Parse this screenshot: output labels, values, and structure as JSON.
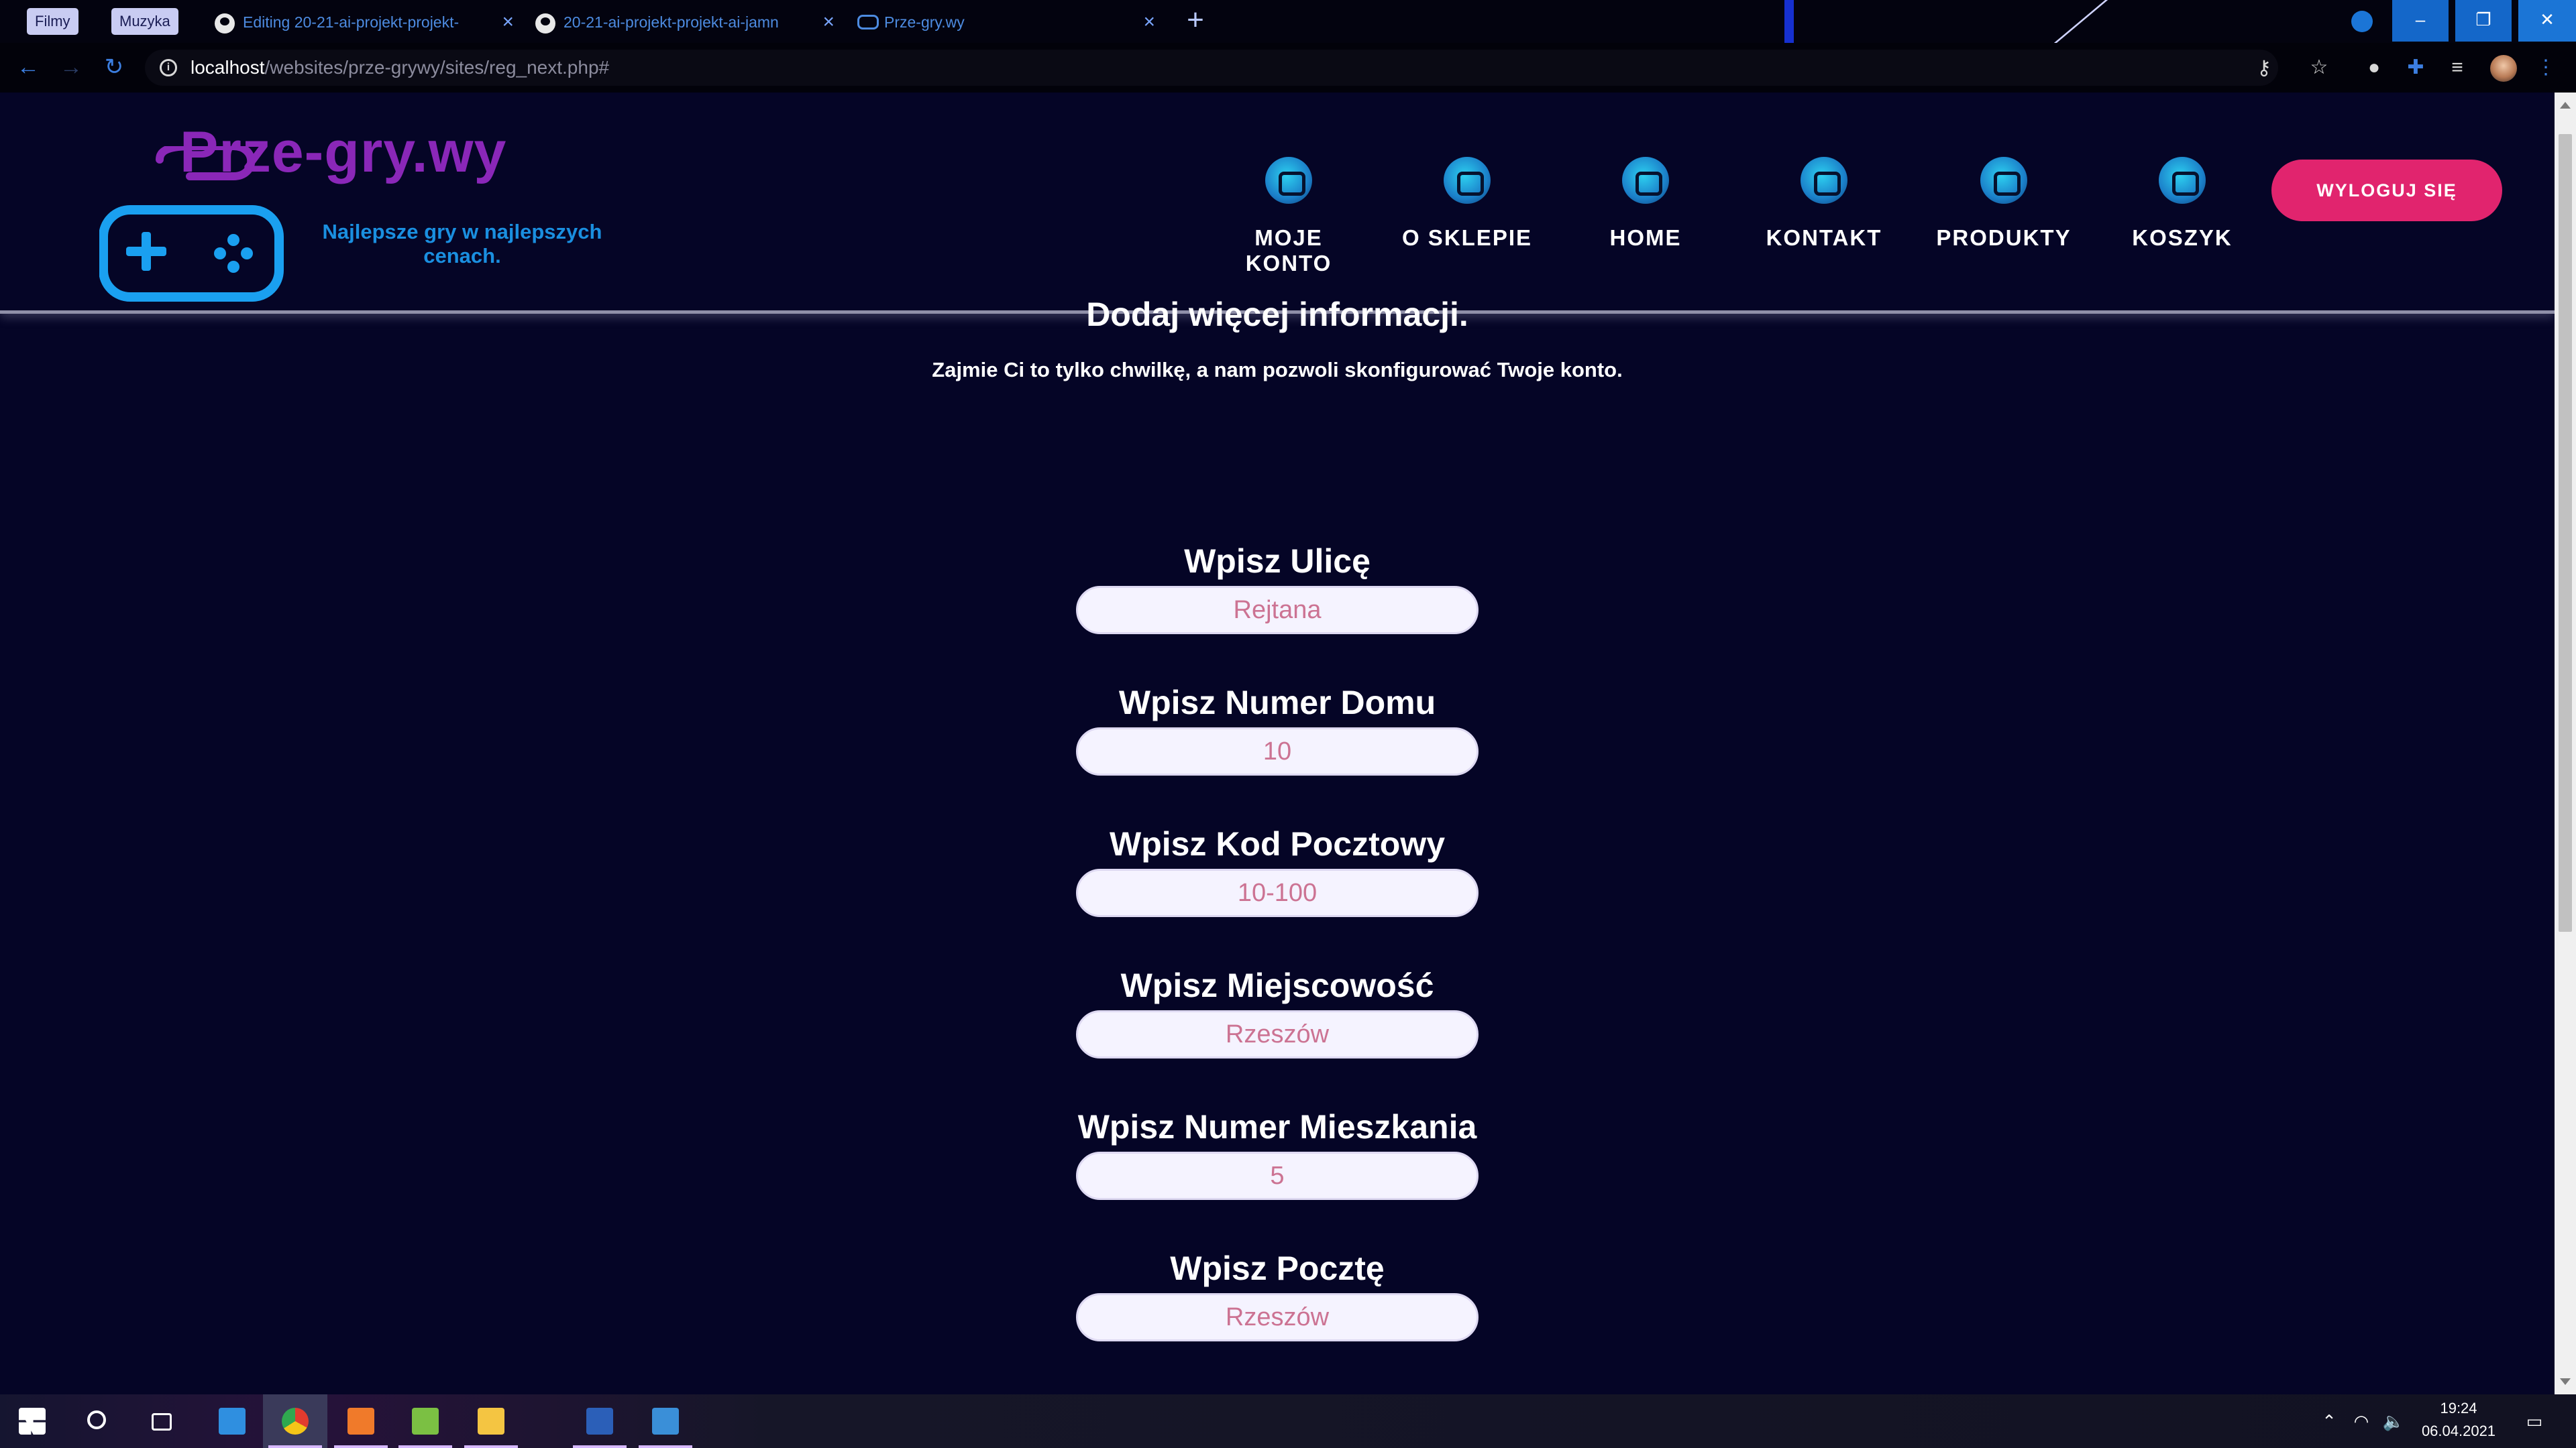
{
  "browser": {
    "bookmarks": [
      "Filmy",
      "Muzyka"
    ],
    "tabs": [
      {
        "title": "Editing 20-21-ai-projekt-projekt-",
        "icon": "github-icon"
      },
      {
        "title": "20-21-ai-projekt-projekt-ai-jamn",
        "icon": "github-icon"
      },
      {
        "title": "Prze-gry.wy",
        "icon": "gamepad-icon"
      }
    ],
    "url_host": "localhost",
    "url_path": "/websites/prze-grywy/sites/reg_next.php#",
    "window_buttons": {
      "minimize": "–",
      "restore": "❐",
      "close": "✕"
    }
  },
  "site": {
    "logo_title": "Prze-gry.wy",
    "logo_tagline": "Najlepsze gry w najlepszych cenach.",
    "nav": [
      {
        "label": "MOJE KONTO",
        "icon": "account-icon"
      },
      {
        "label": "O SKLEPIE",
        "icon": "about-icon"
      },
      {
        "label": "HOME",
        "icon": "home-icon"
      },
      {
        "label": "KONTAKT",
        "icon": "phone-icon"
      },
      {
        "label": "PRODUKTY",
        "icon": "gamepad-icon"
      },
      {
        "label": "KOSZYK",
        "icon": "cart-icon"
      }
    ],
    "logout_label": "WYLOGUJ SIĘ"
  },
  "form": {
    "title": "Dodaj więcej informacji.",
    "subtitle": "Zajmie Ci to tylko chwilkę, a nam pozwoli skonfigurować Twoje konto.",
    "fields": [
      {
        "label": "Wpisz Ulicę",
        "value": "Rejtana"
      },
      {
        "label": "Wpisz Numer Domu",
        "value": "10"
      },
      {
        "label": "Wpisz Kod Pocztowy",
        "value": "10-100"
      },
      {
        "label": "Wpisz Miejscowość",
        "value": "Rzeszów"
      },
      {
        "label": "Wpisz Numer Mieszkania",
        "value": "5"
      },
      {
        "label": "Wpisz Pocztę",
        "value": "Rzeszów"
      }
    ]
  },
  "taskbar": {
    "time": "19:24",
    "date": "06.04.2021"
  },
  "colors": {
    "page_bg": "#050526",
    "accent_pink": "#e1246e",
    "logo_purple": "#8a27b8",
    "logo_blue": "#1a8fe0",
    "input_text": "#cc7393"
  }
}
